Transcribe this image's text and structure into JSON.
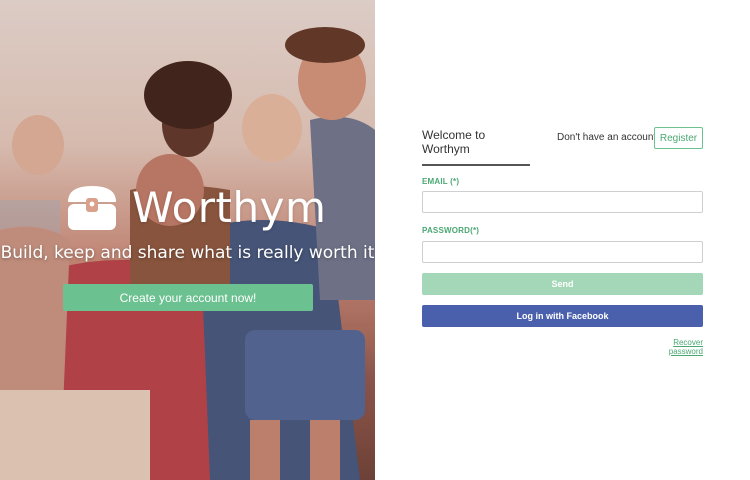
{
  "hero": {
    "brand_name": "Worthym",
    "tagline": "Build, keep and share what is really worth it",
    "cta_label": "Create your account now!"
  },
  "login": {
    "welcome_tab": "Welcome to Worthym",
    "no_account_text": "Don't have an account?",
    "register_label": "Register",
    "email_label": "EMAIL (*)",
    "email_value": "",
    "password_label": "PASSWORD(*)",
    "password_value": "",
    "send_label": "Send",
    "facebook_label": "Log in with Facebook",
    "recover_label": "Recover password"
  },
  "colors": {
    "accent_green": "#6cc190",
    "send_disabled": "#a3d7b7",
    "facebook_blue": "#4b60ad"
  },
  "icons": {
    "brand_logo": "treasure-chest-icon"
  }
}
